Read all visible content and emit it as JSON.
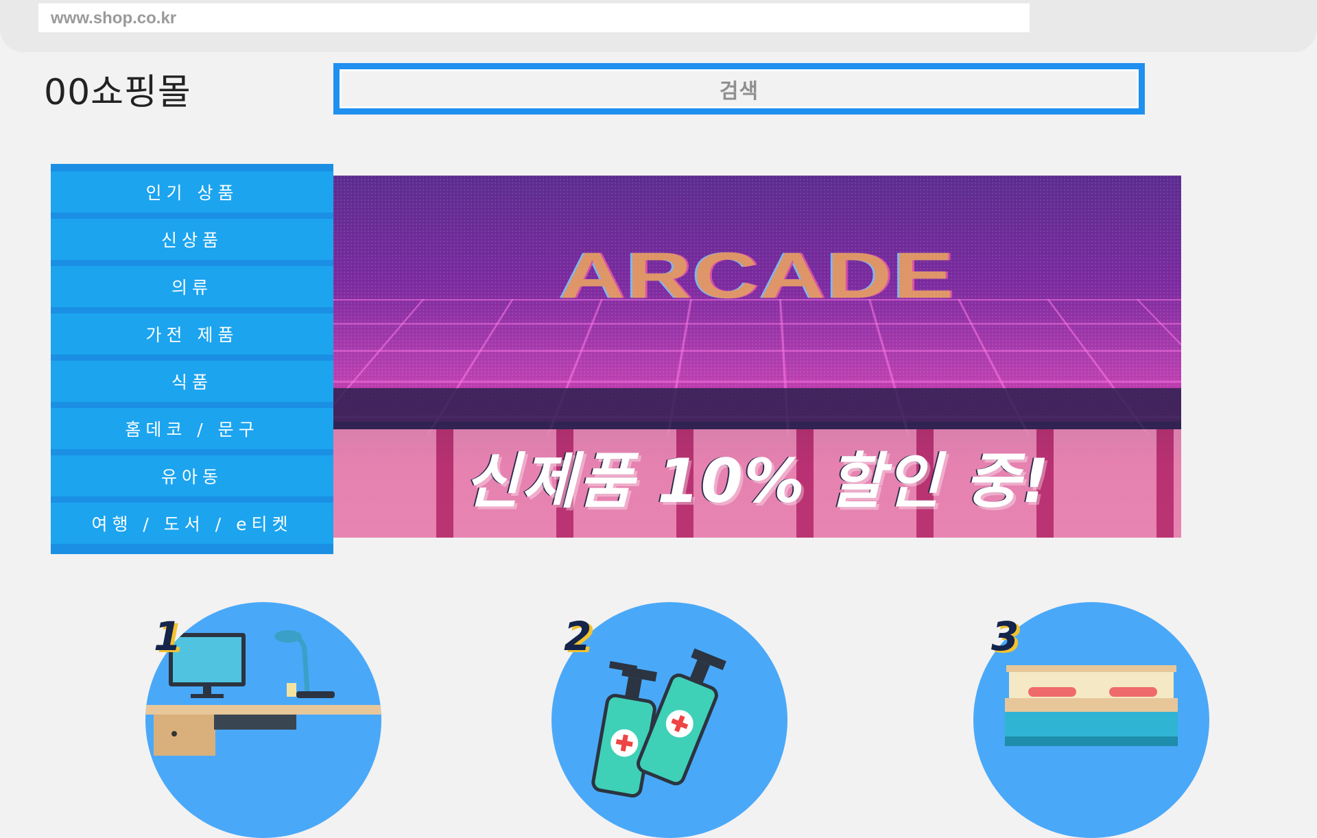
{
  "browser": {
    "url": "www.shop.co.kr"
  },
  "header": {
    "logo": "00쇼핑몰",
    "search_placeholder": "검색"
  },
  "menu": {
    "items": [
      {
        "label": "인기 상품"
      },
      {
        "label": "신상품"
      },
      {
        "label": "의류"
      },
      {
        "label": "가전 제품"
      },
      {
        "label": "식품"
      },
      {
        "label": "홈데코 / 문구"
      },
      {
        "label": "유아동"
      },
      {
        "label": "여행 / 도서 / e티켓"
      }
    ]
  },
  "banner": {
    "title": "ARCADE",
    "promo": "신제품 10% 할인 중!"
  },
  "featured": [
    {
      "number": "1",
      "icon": "desk-computer-icon"
    },
    {
      "number": "2",
      "icon": "sanitizer-bottles-icon"
    },
    {
      "number": "3",
      "icon": "bed-icon"
    }
  ],
  "colors": {
    "accent": "#1f90f0",
    "menu_bg": "#1ca4ef",
    "circle": "#4aa8f8"
  }
}
